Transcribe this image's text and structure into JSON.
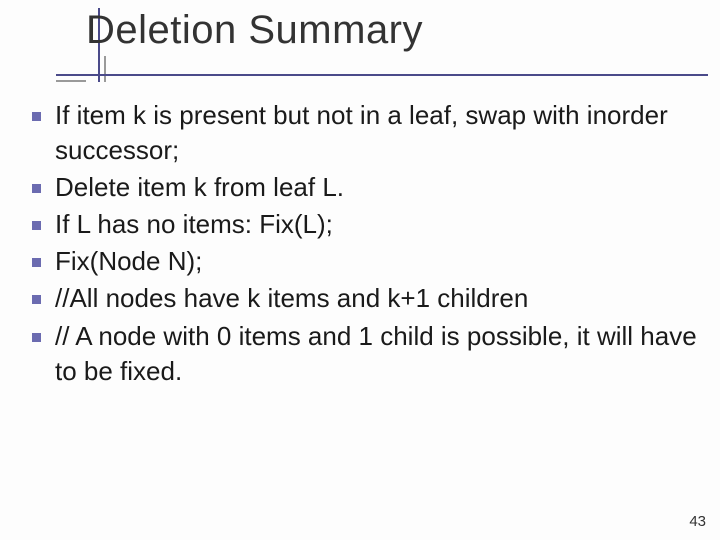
{
  "title": "Deletion Summary",
  "bullets": [
    "If item k is present but not in a leaf, swap with inorder successor;",
    "Delete item k from leaf L.",
    "If L has no items: Fix(L);",
    "Fix(Node  N);",
    "//All nodes have k items and k+1 children",
    "// A node with 0 items and 1 child is possible, it will have to be fixed."
  ],
  "page_number": "43",
  "colors": {
    "accent": "#4a4a8a",
    "bullet": "#6b6bb0"
  }
}
